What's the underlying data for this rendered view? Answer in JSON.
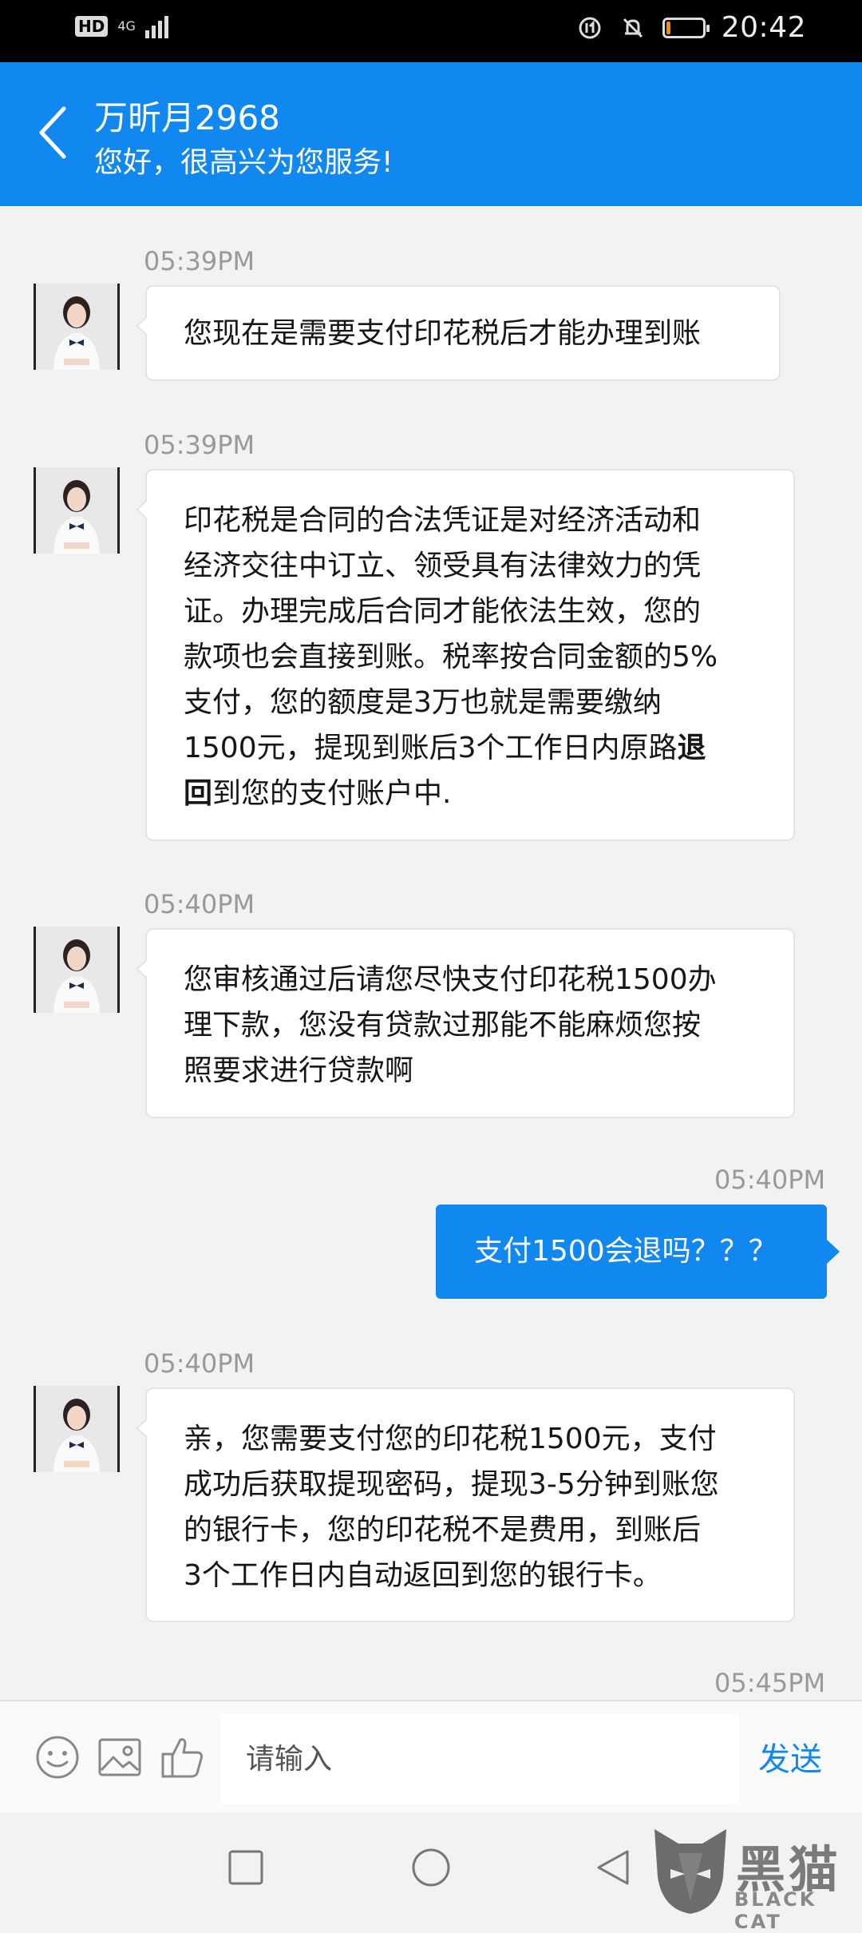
{
  "status_bar": {
    "hd_label": "HD",
    "network_label": "4G",
    "time": "20:42",
    "battery_level": 0.12,
    "battery_color": "#f38a1b"
  },
  "header": {
    "title": "万昕月2968",
    "subtitle": "您好，很高兴为您服务!",
    "back_icon": "chevron-left-icon",
    "background": "#1187f0"
  },
  "messages": [
    {
      "time": "05:39PM",
      "direction": "incoming",
      "lines": [
        "您现在是需要支付印花税后才能办理到账"
      ]
    },
    {
      "time": "05:39PM",
      "direction": "incoming",
      "lines": [
        "印花税是合同的合法凭证是对经济活动和",
        "经济交往中订立、领受具有法律效力的凭",
        "证。办理完成后合同才能依法生效，您的",
        "款项也会直接到账。税率按合同金额的5%",
        "支付，您的额度是3万也就是需要缴纳",
        "1500元，提现到账后3个工作日内原路"
      ],
      "bold_part_1": "退",
      "bold_part_2": "回",
      "tail": "到您的支付账户中."
    },
    {
      "time": "05:40PM",
      "direction": "incoming",
      "lines": [
        "您审核通过后请您尽快支付印花税1500办",
        "理下款，您没有贷款过那能不能麻烦您按",
        "照要求进行贷款啊"
      ]
    },
    {
      "time": "05:40PM",
      "direction": "outgoing",
      "lines": [
        "支付1500会退吗？？？"
      ]
    },
    {
      "time": "05:40PM",
      "direction": "incoming",
      "lines": [
        "亲，您需要支付您的印花税1500元，支付",
        "成功后获取提现密码，提现3-5分钟到账您",
        "的银行卡，您的印花税不是费用，到账后",
        "3个工作日内自动返回到您的银行卡。"
      ]
    },
    {
      "time": "05:45PM",
      "direction": "outgoing",
      "lines": []
    }
  ],
  "input_bar": {
    "placeholder": "请输入",
    "send_label": "发送",
    "icons": [
      "emoji-icon",
      "image-icon",
      "thumbs-up-icon"
    ]
  },
  "nav_bar": {
    "icons": [
      "recent-apps-icon",
      "home-icon",
      "back-icon"
    ]
  },
  "watermark": {
    "main": "黑猫",
    "sub": "BLACK CAT"
  }
}
